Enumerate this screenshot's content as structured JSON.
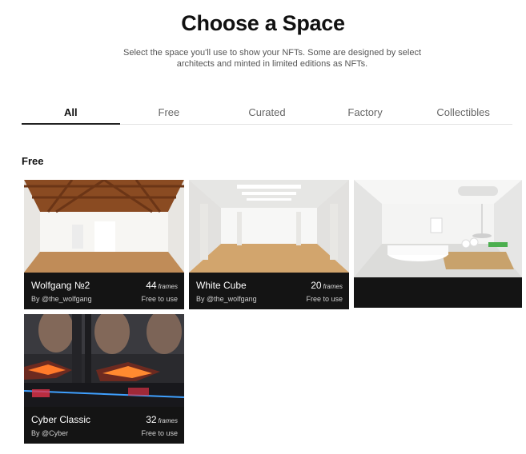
{
  "header": {
    "title": "Choose a Space",
    "subtitle_line1": "Select the space you'll use to show your NFTs. Some are designed by select",
    "subtitle_line2": "architects and minted in limited editions as NFTs."
  },
  "tabs": [
    {
      "label": "All",
      "active": true
    },
    {
      "label": "Free",
      "active": false
    },
    {
      "label": "Curated",
      "active": false
    },
    {
      "label": "Factory",
      "active": false
    },
    {
      "label": "Collectibles",
      "active": false
    }
  ],
  "section": {
    "title": "Free"
  },
  "cards": [
    {
      "name": "Wolfgang №2",
      "author": "By @the_wolfgang",
      "frames": "44",
      "frames_unit": "frames",
      "price": "Free to use"
    },
    {
      "name": "White Cube",
      "author": "By @the_wolfgang",
      "frames": "20",
      "frames_unit": "frames",
      "price": "Free to use"
    },
    {
      "name": "",
      "author": "",
      "frames": "",
      "frames_unit": "",
      "price": ""
    },
    {
      "name": "Cyber Classic",
      "author": "By @Cyber",
      "frames": "32",
      "frames_unit": "frames",
      "price": "Free to use"
    }
  ],
  "colors": {
    "accent": "#111111",
    "card_info_bg": "#141414",
    "tab_underline": "#222222"
  }
}
